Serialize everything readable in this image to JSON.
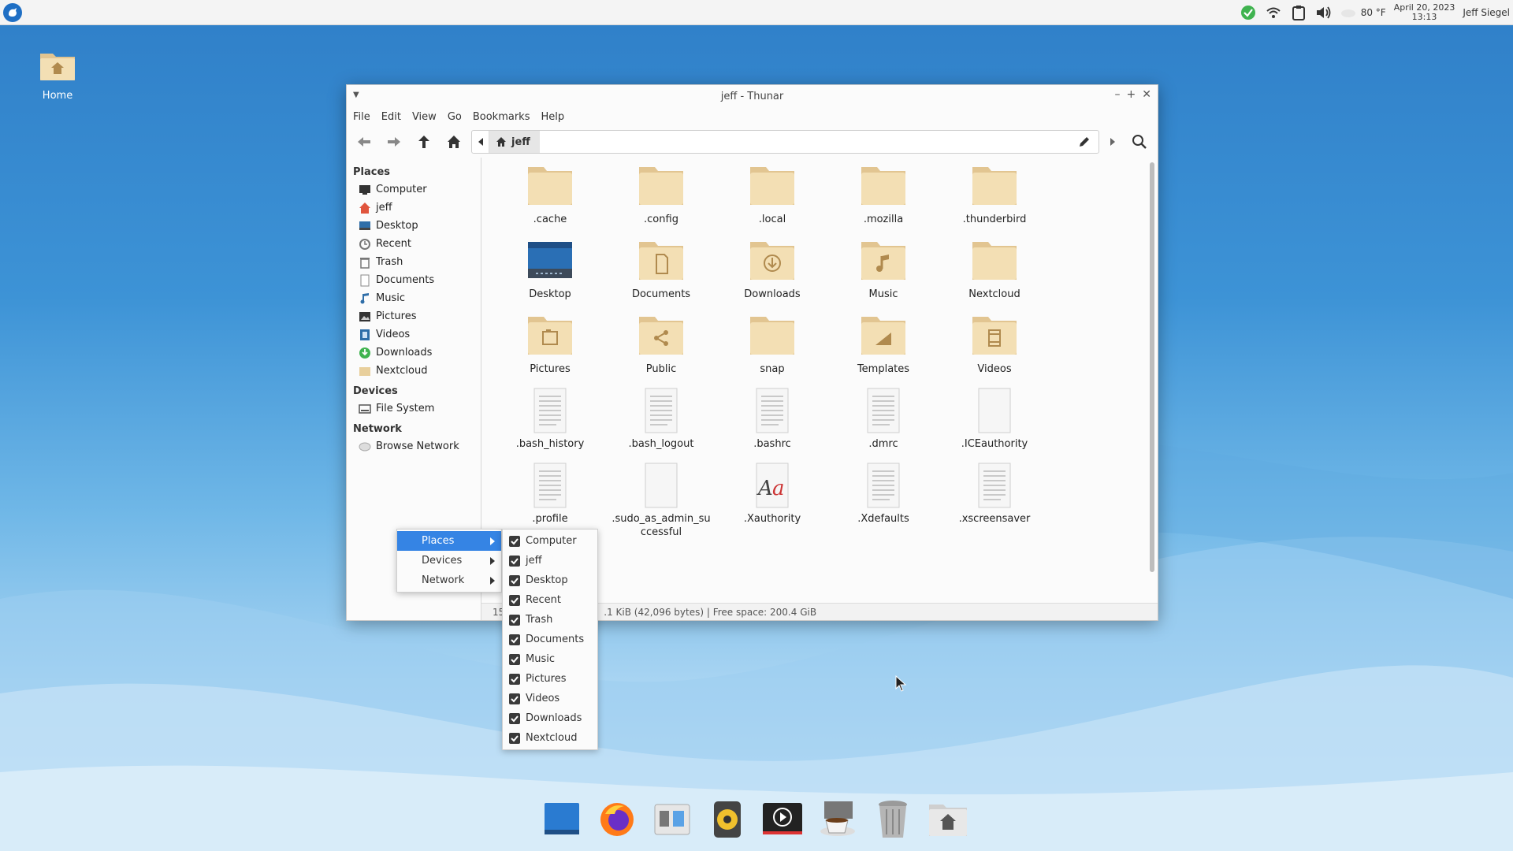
{
  "panel": {
    "weather": "80 °F",
    "date": "April 20, 2023",
    "time": "13:13",
    "user": "Jeff Siegel"
  },
  "desktop": {
    "home_label": "Home"
  },
  "window": {
    "title": "jeff - Thunar",
    "menu": [
      "File",
      "Edit",
      "View",
      "Go",
      "Bookmarks",
      "Help"
    ],
    "path_crumb": "jeff",
    "sidebar": {
      "places_heading": "Places",
      "places": [
        "Computer",
        "jeff",
        "Desktop",
        "Recent",
        "Trash",
        "Documents",
        "Music",
        "Pictures",
        "Videos",
        "Downloads",
        "Nextcloud"
      ],
      "devices_heading": "Devices",
      "devices": [
        "File System"
      ],
      "network_heading": "Network",
      "network": [
        "Browse Network"
      ]
    },
    "files": [
      {
        "name": ".cache",
        "kind": "folder",
        "icon": "folder-icon"
      },
      {
        "name": ".config",
        "kind": "folder",
        "icon": "folder-icon"
      },
      {
        "name": ".local",
        "kind": "folder",
        "icon": "folder-icon"
      },
      {
        "name": ".mozilla",
        "kind": "folder",
        "icon": "folder-icon"
      },
      {
        "name": ".thunderbird",
        "kind": "folder",
        "icon": "folder-icon"
      },
      {
        "name": "Desktop",
        "kind": "desktop",
        "icon": "desktop-folder-icon"
      },
      {
        "name": "Documents",
        "kind": "folder",
        "icon": "documents-folder-icon"
      },
      {
        "name": "Downloads",
        "kind": "folder",
        "icon": "downloads-folder-icon"
      },
      {
        "name": "Music",
        "kind": "folder",
        "icon": "music-folder-icon"
      },
      {
        "name": "Nextcloud",
        "kind": "folder",
        "icon": "folder-icon"
      },
      {
        "name": "Pictures",
        "kind": "folder",
        "icon": "pictures-folder-icon"
      },
      {
        "name": "Public",
        "kind": "folder",
        "icon": "public-folder-icon"
      },
      {
        "name": "snap",
        "kind": "folder",
        "icon": "folder-icon"
      },
      {
        "name": "Templates",
        "kind": "folder",
        "icon": "templates-folder-icon"
      },
      {
        "name": "Videos",
        "kind": "folder",
        "icon": "videos-folder-icon"
      },
      {
        "name": ".bash_history",
        "kind": "text",
        "icon": "text-file-icon"
      },
      {
        "name": ".bash_logout",
        "kind": "text",
        "icon": "text-file-icon"
      },
      {
        "name": ".bashrc",
        "kind": "text",
        "icon": "text-file-icon"
      },
      {
        "name": ".dmrc",
        "kind": "text",
        "icon": "text-file-icon"
      },
      {
        "name": ".ICEauthority",
        "kind": "blank",
        "icon": "blank-file-icon"
      },
      {
        "name": ".profile",
        "kind": "text",
        "icon": "text-file-icon"
      },
      {
        "name": ".sudo_as_admin_successful",
        "kind": "blank",
        "icon": "blank-file-icon"
      },
      {
        "name": ".Xauthority",
        "kind": "font",
        "icon": "font-file-icon"
      },
      {
        "name": ".Xdefaults",
        "kind": "text",
        "icon": "text-file-icon"
      },
      {
        "name": ".xscreensaver",
        "kind": "text",
        "icon": "text-file-icon"
      },
      {
        "name": "",
        "kind": "recycle",
        "icon": "recycle-file-icon"
      }
    ],
    "status": {
      "left": "15",
      "right": ".1 KiB (42,096 bytes)  |  Free space: 200.4 GiB"
    }
  },
  "context_menu": {
    "items": [
      "Places",
      "Devices",
      "Network"
    ],
    "selected": "Places",
    "submenu": [
      "Computer",
      "jeff",
      "Desktop",
      "Recent",
      "Trash",
      "Documents",
      "Music",
      "Pictures",
      "Videos",
      "Downloads",
      "Nextcloud"
    ]
  },
  "colors": {
    "folder": "#f3dfb4",
    "folder_dark": "#e2c591",
    "accent": "#3584e4"
  }
}
